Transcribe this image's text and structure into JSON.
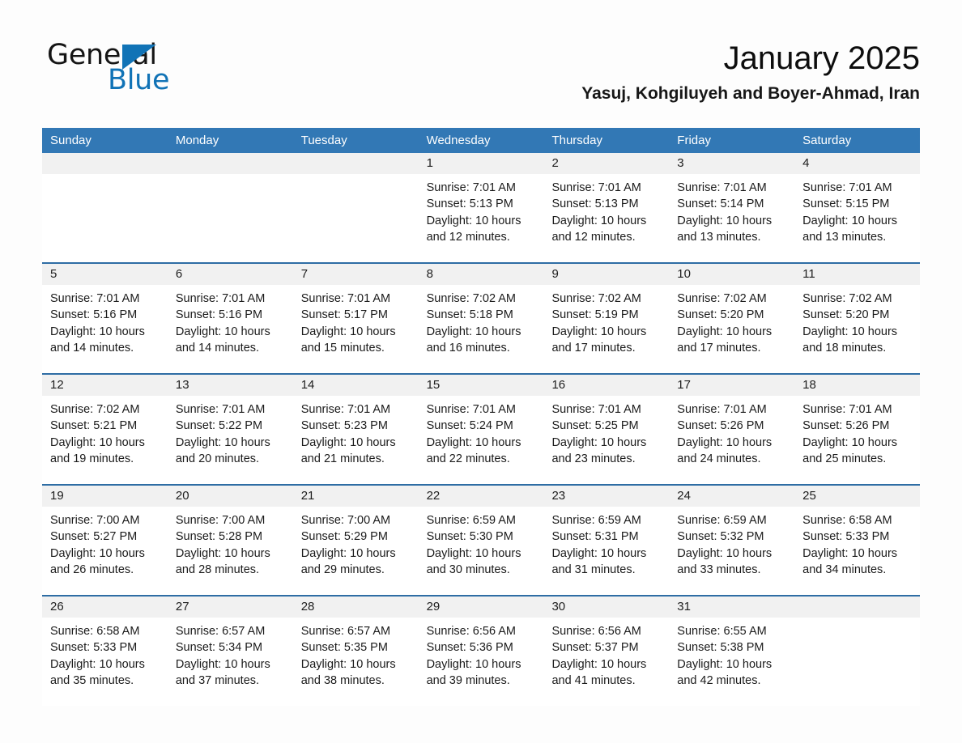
{
  "brand": {
    "name_part1": "General",
    "name_part2": "Blue",
    "triangle_color": "#1173b6",
    "blue_text_color": "#1173b6"
  },
  "header": {
    "title": "January 2025",
    "subtitle": "Yasuj, Kohgiluyeh and Boyer-Ahmad, Iran"
  },
  "theme": {
    "header_blue": "#3278b5",
    "row_divider_blue": "#2e6da4",
    "daynum_band": "#f1f1f1",
    "page_background": "#fdfdfd"
  },
  "calendar": {
    "weekdays": [
      "Sunday",
      "Monday",
      "Tuesday",
      "Wednesday",
      "Thursday",
      "Friday",
      "Saturday"
    ],
    "weeks": [
      [
        {
          "day": "",
          "lines": []
        },
        {
          "day": "",
          "lines": []
        },
        {
          "day": "",
          "lines": []
        },
        {
          "day": "1",
          "lines": [
            "Sunrise: 7:01 AM",
            "Sunset: 5:13 PM",
            "Daylight: 10 hours",
            "and 12 minutes."
          ]
        },
        {
          "day": "2",
          "lines": [
            "Sunrise: 7:01 AM",
            "Sunset: 5:13 PM",
            "Daylight: 10 hours",
            "and 12 minutes."
          ]
        },
        {
          "day": "3",
          "lines": [
            "Sunrise: 7:01 AM",
            "Sunset: 5:14 PM",
            "Daylight: 10 hours",
            "and 13 minutes."
          ]
        },
        {
          "day": "4",
          "lines": [
            "Sunrise: 7:01 AM",
            "Sunset: 5:15 PM",
            "Daylight: 10 hours",
            "and 13 minutes."
          ]
        }
      ],
      [
        {
          "day": "5",
          "lines": [
            "Sunrise: 7:01 AM",
            "Sunset: 5:16 PM",
            "Daylight: 10 hours",
            "and 14 minutes."
          ]
        },
        {
          "day": "6",
          "lines": [
            "Sunrise: 7:01 AM",
            "Sunset: 5:16 PM",
            "Daylight: 10 hours",
            "and 14 minutes."
          ]
        },
        {
          "day": "7",
          "lines": [
            "Sunrise: 7:01 AM",
            "Sunset: 5:17 PM",
            "Daylight: 10 hours",
            "and 15 minutes."
          ]
        },
        {
          "day": "8",
          "lines": [
            "Sunrise: 7:02 AM",
            "Sunset: 5:18 PM",
            "Daylight: 10 hours",
            "and 16 minutes."
          ]
        },
        {
          "day": "9",
          "lines": [
            "Sunrise: 7:02 AM",
            "Sunset: 5:19 PM",
            "Daylight: 10 hours",
            "and 17 minutes."
          ]
        },
        {
          "day": "10",
          "lines": [
            "Sunrise: 7:02 AM",
            "Sunset: 5:20 PM",
            "Daylight: 10 hours",
            "and 17 minutes."
          ]
        },
        {
          "day": "11",
          "lines": [
            "Sunrise: 7:02 AM",
            "Sunset: 5:20 PM",
            "Daylight: 10 hours",
            "and 18 minutes."
          ]
        }
      ],
      [
        {
          "day": "12",
          "lines": [
            "Sunrise: 7:02 AM",
            "Sunset: 5:21 PM",
            "Daylight: 10 hours",
            "and 19 minutes."
          ]
        },
        {
          "day": "13",
          "lines": [
            "Sunrise: 7:01 AM",
            "Sunset: 5:22 PM",
            "Daylight: 10 hours",
            "and 20 minutes."
          ]
        },
        {
          "day": "14",
          "lines": [
            "Sunrise: 7:01 AM",
            "Sunset: 5:23 PM",
            "Daylight: 10 hours",
            "and 21 minutes."
          ]
        },
        {
          "day": "15",
          "lines": [
            "Sunrise: 7:01 AM",
            "Sunset: 5:24 PM",
            "Daylight: 10 hours",
            "and 22 minutes."
          ]
        },
        {
          "day": "16",
          "lines": [
            "Sunrise: 7:01 AM",
            "Sunset: 5:25 PM",
            "Daylight: 10 hours",
            "and 23 minutes."
          ]
        },
        {
          "day": "17",
          "lines": [
            "Sunrise: 7:01 AM",
            "Sunset: 5:26 PM",
            "Daylight: 10 hours",
            "and 24 minutes."
          ]
        },
        {
          "day": "18",
          "lines": [
            "Sunrise: 7:01 AM",
            "Sunset: 5:26 PM",
            "Daylight: 10 hours",
            "and 25 minutes."
          ]
        }
      ],
      [
        {
          "day": "19",
          "lines": [
            "Sunrise: 7:00 AM",
            "Sunset: 5:27 PM",
            "Daylight: 10 hours",
            "and 26 minutes."
          ]
        },
        {
          "day": "20",
          "lines": [
            "Sunrise: 7:00 AM",
            "Sunset: 5:28 PM",
            "Daylight: 10 hours",
            "and 28 minutes."
          ]
        },
        {
          "day": "21",
          "lines": [
            "Sunrise: 7:00 AM",
            "Sunset: 5:29 PM",
            "Daylight: 10 hours",
            "and 29 minutes."
          ]
        },
        {
          "day": "22",
          "lines": [
            "Sunrise: 6:59 AM",
            "Sunset: 5:30 PM",
            "Daylight: 10 hours",
            "and 30 minutes."
          ]
        },
        {
          "day": "23",
          "lines": [
            "Sunrise: 6:59 AM",
            "Sunset: 5:31 PM",
            "Daylight: 10 hours",
            "and 31 minutes."
          ]
        },
        {
          "day": "24",
          "lines": [
            "Sunrise: 6:59 AM",
            "Sunset: 5:32 PM",
            "Daylight: 10 hours",
            "and 33 minutes."
          ]
        },
        {
          "day": "25",
          "lines": [
            "Sunrise: 6:58 AM",
            "Sunset: 5:33 PM",
            "Daylight: 10 hours",
            "and 34 minutes."
          ]
        }
      ],
      [
        {
          "day": "26",
          "lines": [
            "Sunrise: 6:58 AM",
            "Sunset: 5:33 PM",
            "Daylight: 10 hours",
            "and 35 minutes."
          ]
        },
        {
          "day": "27",
          "lines": [
            "Sunrise: 6:57 AM",
            "Sunset: 5:34 PM",
            "Daylight: 10 hours",
            "and 37 minutes."
          ]
        },
        {
          "day": "28",
          "lines": [
            "Sunrise: 6:57 AM",
            "Sunset: 5:35 PM",
            "Daylight: 10 hours",
            "and 38 minutes."
          ]
        },
        {
          "day": "29",
          "lines": [
            "Sunrise: 6:56 AM",
            "Sunset: 5:36 PM",
            "Daylight: 10 hours",
            "and 39 minutes."
          ]
        },
        {
          "day": "30",
          "lines": [
            "Sunrise: 6:56 AM",
            "Sunset: 5:37 PM",
            "Daylight: 10 hours",
            "and 41 minutes."
          ]
        },
        {
          "day": "31",
          "lines": [
            "Sunrise: 6:55 AM",
            "Sunset: 5:38 PM",
            "Daylight: 10 hours",
            "and 42 minutes."
          ]
        },
        {
          "day": "",
          "lines": []
        }
      ]
    ]
  }
}
